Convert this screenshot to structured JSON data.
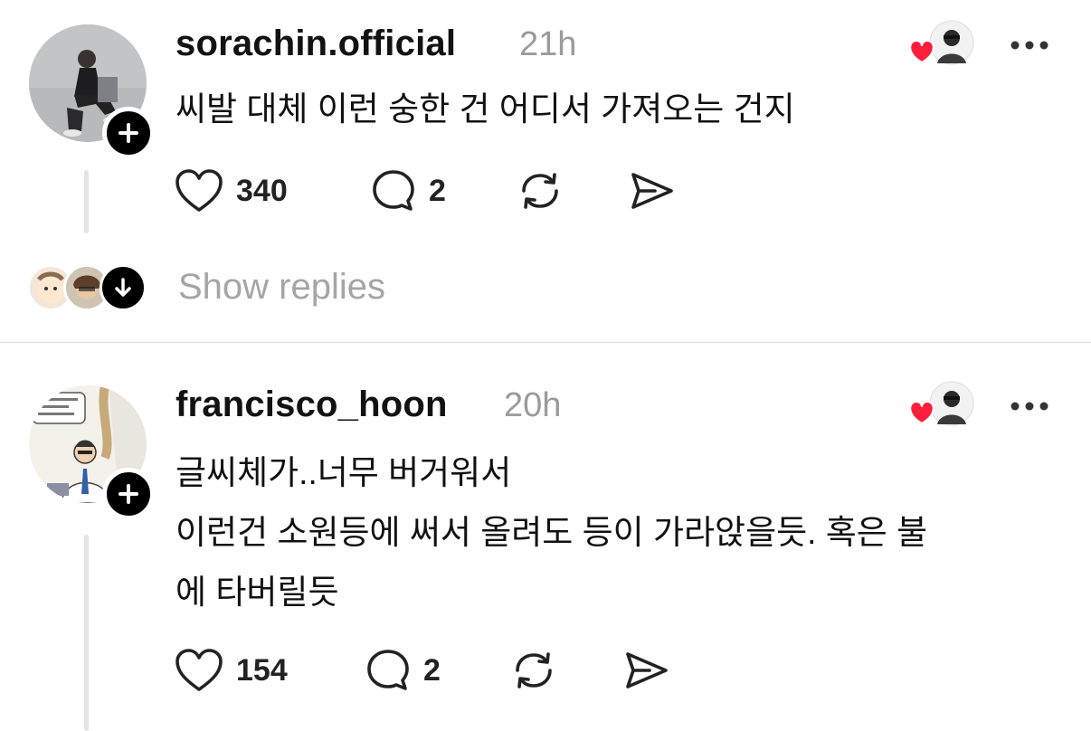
{
  "posts": [
    {
      "username": "sorachin.official",
      "time": "21h",
      "lines": [
        "씨발 대체 이런 숭한 건 어디서 가져오는 건지"
      ],
      "likes": "340",
      "replies": "2",
      "avatar_icon": "person-photo-avatar",
      "liked_by_author": true
    },
    {
      "username": "francisco_hoon",
      "time": "20h",
      "lines": [
        "글씨체가..너무 버거워서",
        "이런건 소원등에 써서 올려도 등이 가라앉을듯. 혹은 불",
        "에 타버릴듯"
      ],
      "likes": "154",
      "replies": "2",
      "avatar_icon": "comic-doctor-avatar",
      "liked_by_author": true
    }
  ],
  "show_replies_label": "Show replies",
  "colors": {
    "heart": "#ff1e3c",
    "text": "#111111",
    "muted": "#9b9b9b",
    "thread_line": "#e4e4e4",
    "divider": "#dcdcdc"
  }
}
